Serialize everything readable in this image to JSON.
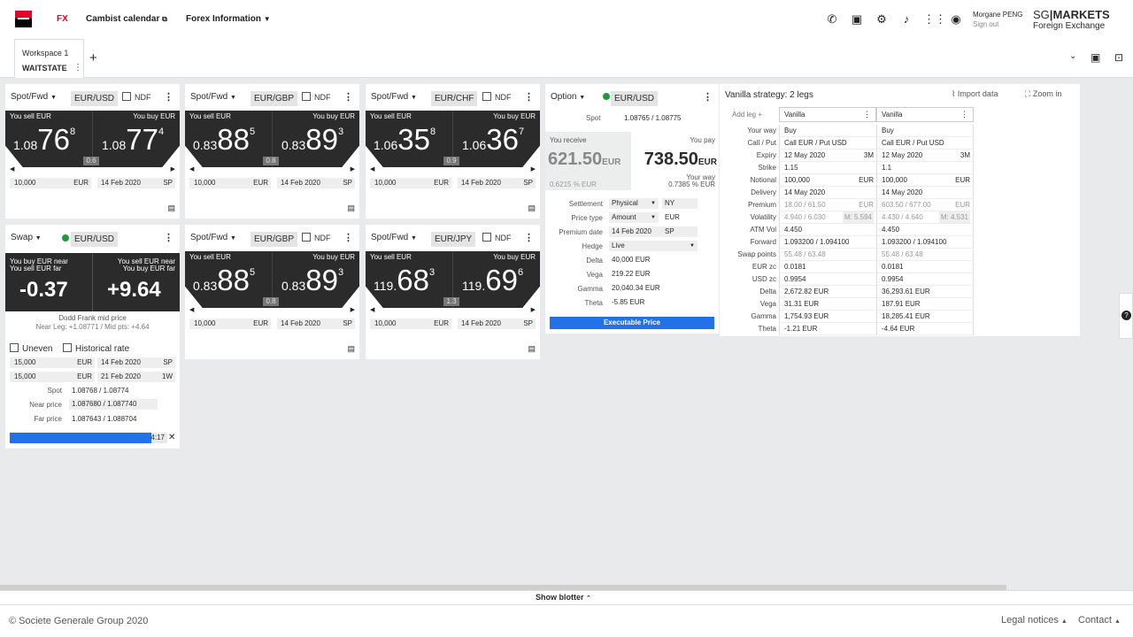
{
  "header": {
    "fx": "FX",
    "cambist": "Cambist calendar",
    "forex": "Forex Information",
    "user": "Morgane PENG",
    "signout": "Sign out",
    "brand1": "SG",
    "brand2": "MARKETS",
    "brand3": "Foreign Exchange"
  },
  "workspace": {
    "name": "Workspace 1",
    "state": "WAITSTATE",
    "add": "+"
  },
  "tiles": [
    {
      "type": "Spot/Fwd",
      "pair": "EUR/USD",
      "ndf": "NDF",
      "sellLabel": "You sell EUR",
      "buyLabel": "You buy EUR",
      "sellSmall": "1.08",
      "sellBig": "76",
      "sellSup": "8",
      "buySmall": "1.08",
      "buyBig": "77",
      "buySup": "4",
      "spread": "0.6",
      "amount": "10,000",
      "ccy": "EUR",
      "date": "14 Feb 2020",
      "tenor": "SP"
    },
    {
      "type": "Spot/Fwd",
      "pair": "EUR/GBP",
      "ndf": "NDF",
      "sellLabel": "You sell EUR",
      "buyLabel": "You buy EUR",
      "sellSmall": "0.83",
      "sellBig": "88",
      "sellSup": "5",
      "buySmall": "0.83",
      "buyBig": "89",
      "buySup": "3",
      "spread": "0.8",
      "amount": "10,000",
      "ccy": "EUR",
      "date": "14 Feb 2020",
      "tenor": "SP"
    },
    {
      "type": "Spot/Fwd",
      "pair": "EUR/CHF",
      "ndf": "NDF",
      "sellLabel": "You sell EUR",
      "buyLabel": "You buy EUR",
      "sellSmall": "1.06",
      "sellBig": "35",
      "sellSup": "8",
      "buySmall": "1.06",
      "buyBig": "36",
      "buySup": "7",
      "spread": "0.9",
      "amount": "10,000",
      "ccy": "EUR",
      "date": "14 Feb 2020",
      "tenor": "SP"
    },
    {
      "type": "Spot/Fwd",
      "pair": "EUR/GBP",
      "ndf": "NDF",
      "sellLabel": "You sell EUR",
      "buyLabel": "You buy EUR",
      "sellSmall": "0.83",
      "sellBig": "88",
      "sellSup": "5",
      "buySmall": "0.83",
      "buyBig": "89",
      "buySup": "3",
      "spread": "0.8",
      "amount": "10,000",
      "ccy": "EUR",
      "date": "14 Feb 2020",
      "tenor": "SP"
    },
    {
      "type": "Spot/Fwd",
      "pair": "EUR/JPY",
      "ndf": "NDF",
      "sellLabel": "You sell EUR",
      "buyLabel": "You buy EUR",
      "sellSmall": "119.",
      "sellBig": "68",
      "sellSup": "3",
      "buySmall": "119.",
      "buyBig": "69",
      "buySup": "6",
      "spread": "1.3",
      "amount": "10,000",
      "ccy": "EUR",
      "date": "14 Feb 2020",
      "tenor": "SP"
    }
  ],
  "swap": {
    "type": "Swap",
    "pair": "EUR/USD",
    "leftTop": "You buy EUR near",
    "leftBot": "You sell EUR far",
    "rightTop": "You sell EUR near",
    "rightBot": "You buy EUR far",
    "left": "-0.37",
    "right": "+9.64",
    "dodd": "Dodd Frank mid price",
    "near": "Near Leg: +1.08771 / Mid pts: +4.64",
    "uneven": "Uneven",
    "hist": "Historical rate",
    "row1": {
      "amt": "15,000",
      "ccy": "EUR",
      "date": "14 Feb 2020",
      "tenor": "SP"
    },
    "row2": {
      "amt": "15,000",
      "ccy": "EUR",
      "date": "21 Feb 2020",
      "tenor": "1W"
    },
    "spotL": "Spot",
    "spot": "1.08768 / 1.08774",
    "nearL": "Near price",
    "nearP": "1.087680 / 1.087740",
    "farL": "Far price",
    "farP": "1.087643 / 1.088704",
    "timer": "4:17",
    "progress": 0.9
  },
  "option": {
    "type": "Option",
    "pair": "EUR/USD",
    "spotL": "Spot",
    "spot": "1.08765 / 1.08775",
    "receive": "You receive",
    "pay": "You pay",
    "recv": "621.50",
    "recvCcy": "EUR",
    "payv": "738.50",
    "payCcy": "EUR",
    "recvPct": "0.6215 % EUR",
    "yourway": "Your way",
    "payPct": "0.7385 % EUR",
    "fields": [
      {
        "l": "Settlement",
        "v": "Physical",
        "v2": "NY"
      },
      {
        "l": "Price type",
        "v": "Amount",
        "v2": "EUR"
      },
      {
        "l": "Premium date",
        "v": "14 Feb 2020",
        "v2": "SP"
      },
      {
        "l": "Hedge",
        "v": "Live",
        "v2": ""
      },
      {
        "l": "Delta",
        "v": "40,000 EUR",
        "v2": ""
      },
      {
        "l": "Vega",
        "v": "219.22 EUR",
        "v2": ""
      },
      {
        "l": "Gamma",
        "v": "20,040.34 EUR",
        "v2": ""
      },
      {
        "l": "Theta",
        "v": "-5.85 EUR",
        "v2": ""
      }
    ],
    "exec": "Executable Price"
  },
  "vanilla": {
    "title": "Vanilla strategy: 2 legs",
    "import": "Import data",
    "zoom": "Zoom in",
    "addLeg": "Add leg",
    "leg1": "Vanilla",
    "leg2": "Vanilla",
    "rows": [
      {
        "l": "Your way",
        "a": "Buy",
        "b": "Buy"
      },
      {
        "l": "Call / Put",
        "a": "Call EUR / Put USD",
        "b": "Call EUR / Put USD"
      },
      {
        "l": "Expiry",
        "a": "12 May 2020",
        "a2": "3M",
        "b": "12 May 2020",
        "b2": "3M"
      },
      {
        "l": "Strike",
        "a": "1.15",
        "b": "1.1"
      },
      {
        "l": "Notional",
        "a": "100,000",
        "a2": "EUR",
        "b": "100,000",
        "b2": "EUR"
      },
      {
        "l": "Delivery",
        "a": "14 May 2020",
        "b": "14 May 2020"
      },
      {
        "l": "Premium",
        "a": "18.00 / 61.50",
        "a2": "EUR",
        "b": "603.50 / 677.00",
        "b2": "EUR"
      },
      {
        "l": "Volatility",
        "a": "4.940 / 6.030",
        "a2": "M: 5.594",
        "b": "4.430 / 4.640",
        "b2": "M: 4.531"
      },
      {
        "l": "ATM Vol",
        "a": "4.450",
        "b": "4.450"
      },
      {
        "l": "Forward",
        "a": "1.093200 / 1.094100",
        "b": "1.093200 / 1.094100"
      },
      {
        "l": "Swap points",
        "a": "55.48 / 63.48",
        "b": "55.48 / 63.48"
      },
      {
        "l": "EUR zc",
        "a": "0.0181",
        "b": "0.0181"
      },
      {
        "l": "USD zc",
        "a": "0.9954",
        "b": "0.9954"
      },
      {
        "l": "Delta",
        "a": "2,672.82 EUR",
        "b": "36,293.61 EUR"
      },
      {
        "l": "Vega",
        "a": "31.31 EUR",
        "b": "187.91 EUR"
      },
      {
        "l": "Gamma",
        "a": "1,754.93 EUR",
        "b": "18,285.41 EUR"
      },
      {
        "l": "Theta",
        "a": "-1.21 EUR",
        "b": "-4.64 EUR"
      }
    ]
  },
  "blotter": "Show blotter",
  "footer": {
    "copy": "© Societe Generale Group 2020",
    "legal": "Legal notices",
    "contact": "Contact"
  }
}
